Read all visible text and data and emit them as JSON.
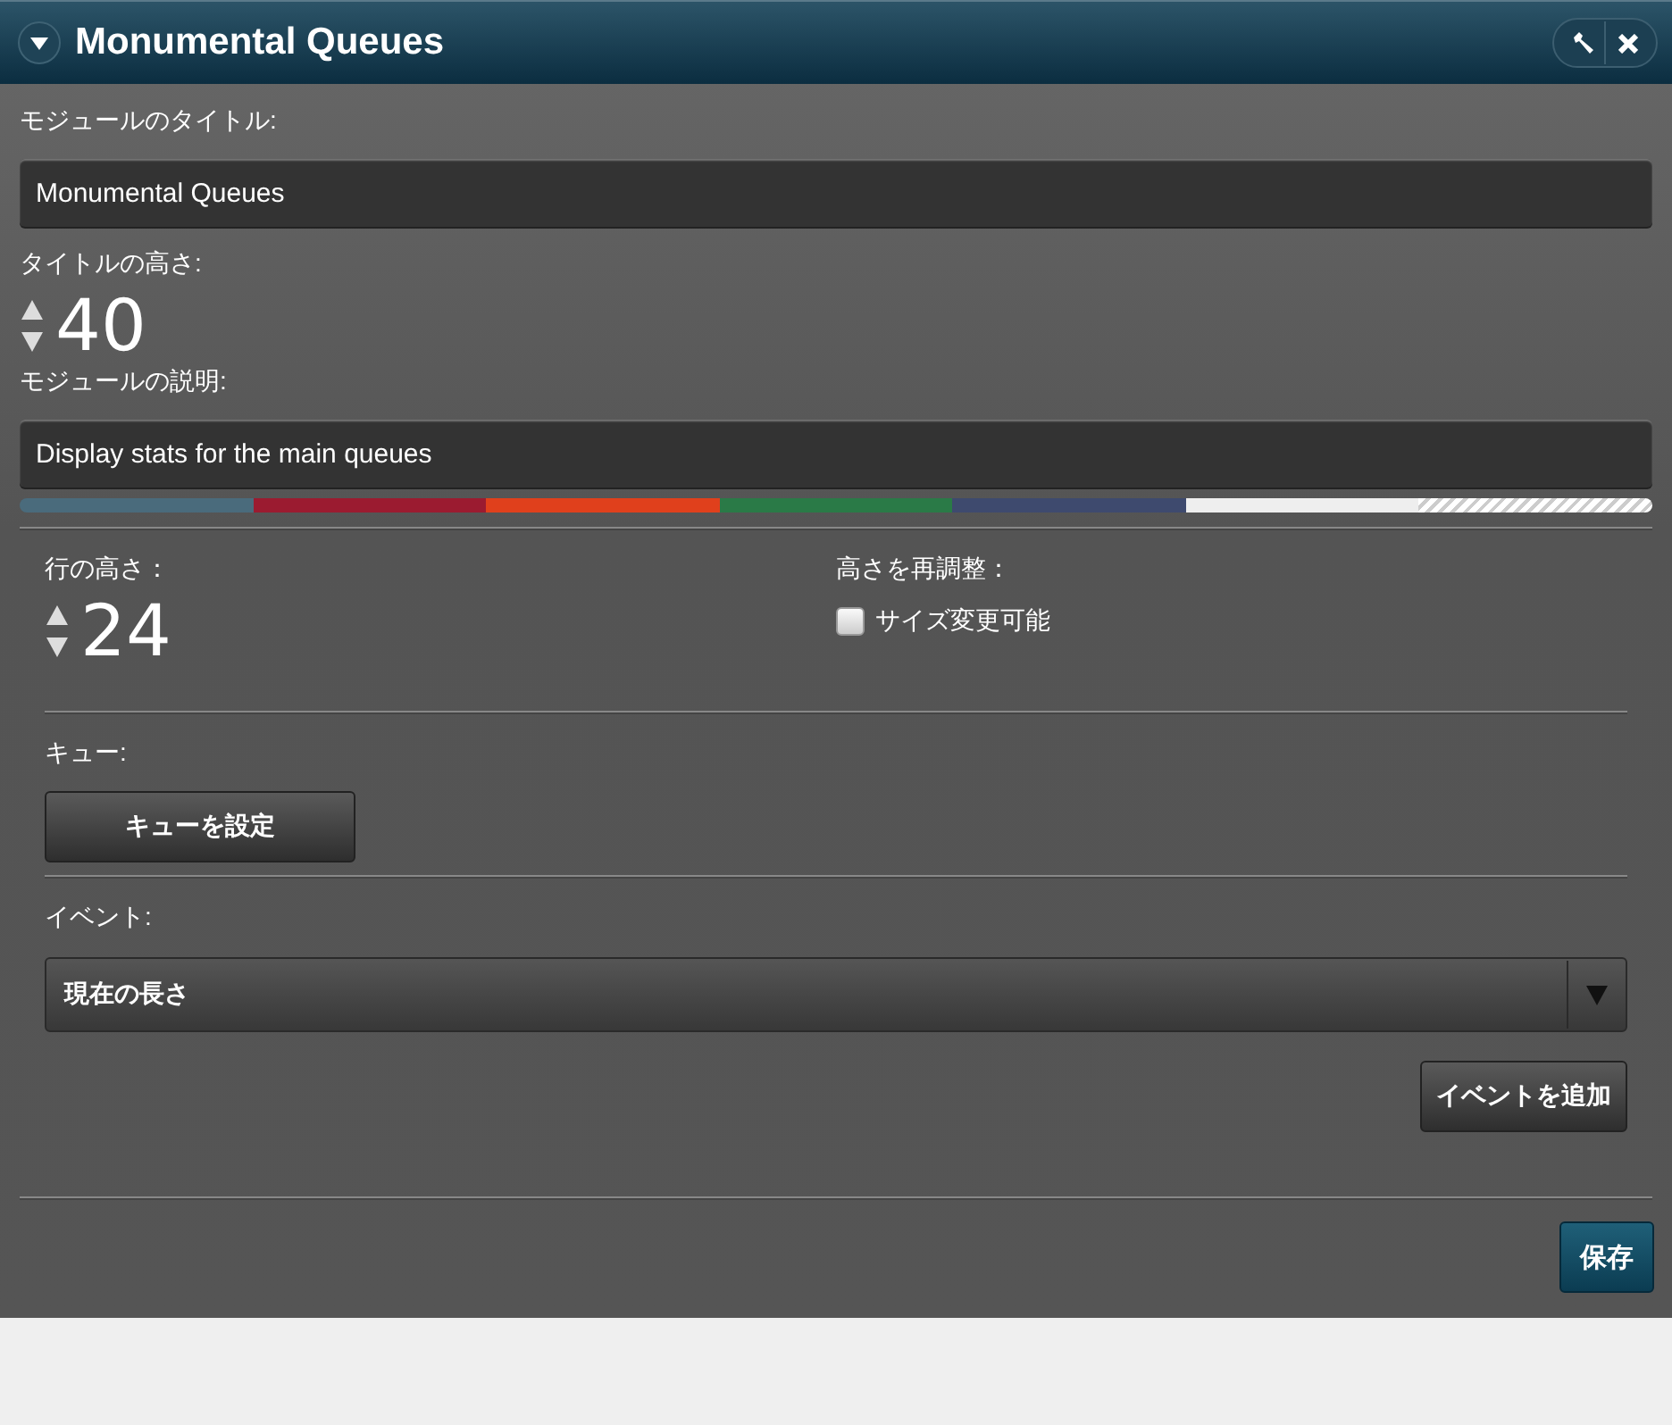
{
  "window": {
    "title": "Monumental Queues"
  },
  "module_title": {
    "label": "モジュールのタイトル:",
    "value": "Monumental Queues"
  },
  "title_height": {
    "label": "タイトルの高さ:",
    "value": "40"
  },
  "module_description": {
    "label": "モジュールの説明:",
    "value": "Display stats for the main queues"
  },
  "color_swatches": [
    {
      "kind": "solid",
      "color": "#4a6b7c"
    },
    {
      "kind": "solid",
      "color": "#9b1b30"
    },
    {
      "kind": "solid",
      "color": "#e0401c"
    },
    {
      "kind": "solid",
      "color": "#2a7a47"
    },
    {
      "kind": "solid",
      "color": "#3e4a6e"
    },
    {
      "kind": "solid",
      "color": "#eeeeee"
    },
    {
      "kind": "none"
    }
  ],
  "row_height": {
    "label": "行の高さ：",
    "value": "24"
  },
  "resize": {
    "label": "高さを再調整：",
    "option": "サイズ変更可能",
    "checked": false
  },
  "queue": {
    "label": "キュー:",
    "button": "キューを設定"
  },
  "event": {
    "label": "イベント:",
    "value": "現在の長さ",
    "button": "イベントを追加"
  },
  "save_button": "保存"
}
